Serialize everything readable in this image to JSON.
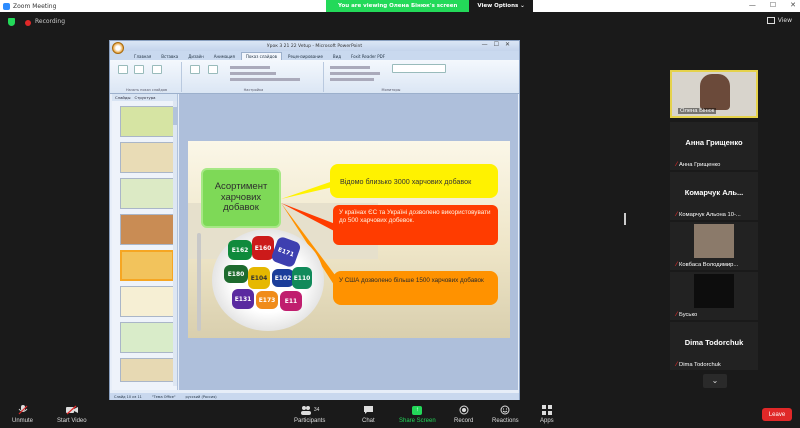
{
  "window": {
    "title": "Zoom Meeting",
    "controls": [
      "—",
      "☐",
      "✕"
    ]
  },
  "share_banner": {
    "viewing": "You are viewing Олена Бінюк's screen",
    "view_options": "View Options ⌄"
  },
  "recording": {
    "label": "Recording"
  },
  "view": {
    "label": "View"
  },
  "ppt": {
    "title": "Урок 3 21 22 Vetup - Microsoft PowerPoint",
    "tabs": [
      "Главная",
      "Вставка",
      "Дизайн",
      "Анимация",
      "Показ слайдов",
      "Рецензирование",
      "Вид",
      "Foxit Reader PDF"
    ],
    "active_tab": "Показ слайдов",
    "ribbon_groups": [
      "Начать показ слайдов",
      "Настройка",
      "Мониторы"
    ],
    "panel_tabs": [
      "Слайды",
      "Структура"
    ],
    "status": {
      "slide": "Слайд 10 из 11",
      "theme": "\"Тема Office\"",
      "language": "русский (Россия)"
    }
  },
  "slide": {
    "green_box": "Асортимент харчових добавок",
    "yellow_box": "Відомо близько 3000 харчових добавок",
    "red_box": "У країнах ЄС та Україні дозволено використовувати до 500 харчових добевок.",
    "orange_box": "У США дозволено більше 1500 харчових добавок",
    "pills": [
      "E162",
      "E160",
      "E171",
      "E180",
      "E104",
      "E102",
      "E110",
      "E131",
      "E173",
      "E11"
    ]
  },
  "participants": [
    {
      "display_name": "",
      "tag": "Олена Бінюк",
      "muted": false,
      "has_video": true,
      "active": true
    },
    {
      "display_name": "Анна Грищенко",
      "tag": "Анна Грищенко",
      "muted": true,
      "has_video": false,
      "active": false
    },
    {
      "display_name": "Комарчук Аль...",
      "tag": "Комарчук Альона 10-...",
      "muted": true,
      "has_video": false,
      "active": false
    },
    {
      "display_name": "",
      "tag": "Ковбаса Володимир...",
      "muted": true,
      "has_video": true,
      "active": false
    },
    {
      "display_name": "",
      "tag": "Бусько",
      "muted": true,
      "has_video": true,
      "active": false
    },
    {
      "display_name": "Dima Todorchuk",
      "tag": "Dima Todorchuk",
      "muted": true,
      "has_video": false,
      "active": false
    }
  ],
  "toolbar": {
    "unmute": "Unmute",
    "start_video": "Start Video",
    "participants": "Participants",
    "participants_count": "34",
    "chat": "Chat",
    "share_screen": "Share Screen",
    "record": "Record",
    "reactions": "Reactions",
    "apps": "Apps",
    "leave": "Leave"
  }
}
